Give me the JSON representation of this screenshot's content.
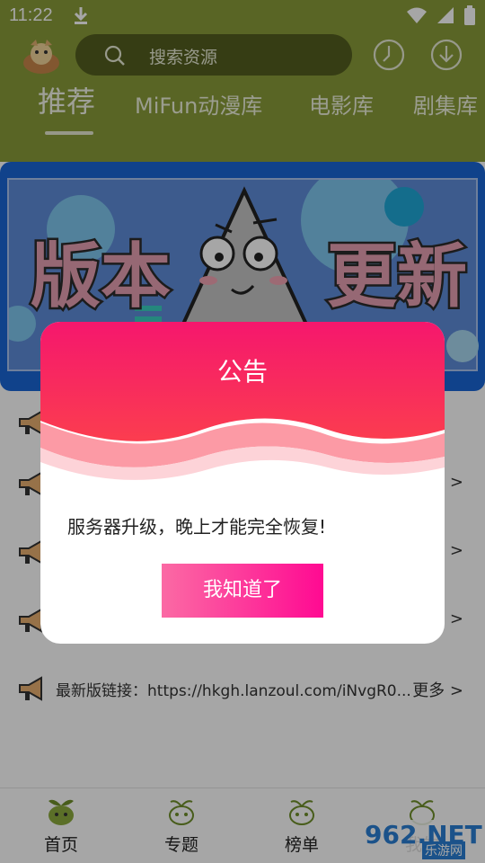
{
  "status_bar": {
    "time": "11:22"
  },
  "search": {
    "placeholder": "搜索资源"
  },
  "tabs": [
    {
      "label": "推荐",
      "active": true
    },
    {
      "label": "MiFun动漫库",
      "active": false
    },
    {
      "label": "电影库",
      "active": false
    },
    {
      "label": "剧集库",
      "active": false
    }
  ],
  "banner": {
    "text_left": "版本",
    "text_right": "更新"
  },
  "notices": [
    {
      "text": "最新版链接：https://hkgh.lanzoul.com/iNvgR0...",
      "more": "更多 >"
    },
    {
      "more": ">"
    },
    {
      "more": ">"
    },
    {
      "more": ">"
    }
  ],
  "bottom_nav": [
    {
      "label": "首页",
      "icon": "sprout-icon"
    },
    {
      "label": "专题",
      "icon": "sprout-icon"
    },
    {
      "label": "榜单",
      "icon": "sprout-icon"
    },
    {
      "label": "我的",
      "icon": "sprout-icon"
    }
  ],
  "watermark": {
    "big": "962.NET",
    "small": "乐游网"
  },
  "dialog": {
    "title": "公告",
    "message": "服务器升级，晚上才能完全恢复!",
    "button": "我知道了"
  },
  "colors": {
    "header": "#899b3a",
    "dialog_head_top": "#f5176d",
    "dialog_head_bottom": "#fb3d4f",
    "button_start": "#fb6aa4",
    "button_end": "#ff0a92"
  }
}
